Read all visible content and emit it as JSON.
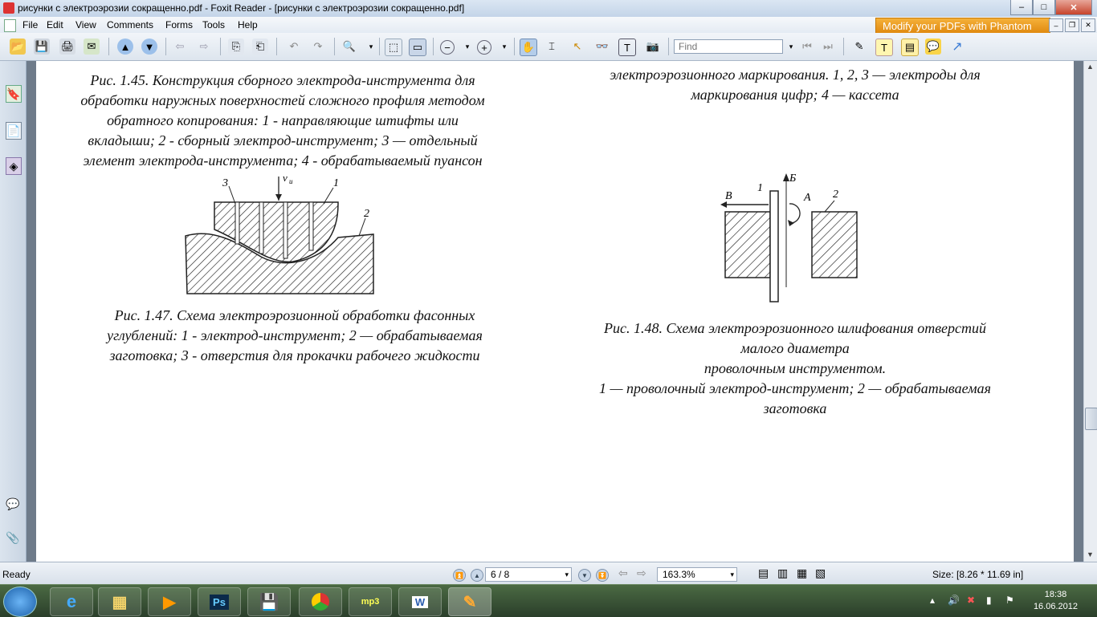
{
  "window": {
    "title": "рисунки с электроэрозии сокращенно.pdf - Foxit Reader - [рисунки с электроэрозии сокращенно.pdf]",
    "minimize": "‒",
    "maximize": "□",
    "close": "✕"
  },
  "menu": {
    "items": [
      "File",
      "Edit",
      "View",
      "Comments",
      "Forms",
      "Tools",
      "Help"
    ],
    "promo": "Modify your PDFs with Phantom",
    "mdi": [
      "–",
      "❐",
      "✕"
    ]
  },
  "toolbar": {
    "find_placeholder": "Find",
    "icons": [
      "open-icon",
      "save-icon",
      "print-icon",
      "email-icon",
      "prev-page-icon",
      "next-page-icon",
      "back-icon",
      "forward-icon",
      "page-extract-icon",
      "page-insert-icon",
      "undo-icon",
      "redo-icon",
      "zoom-in-icon",
      "fit-page-icon",
      "fit-width-icon",
      "zoom-out-icon",
      "zoom-plus-icon",
      "hand-icon",
      "select-text-icon",
      "select-icon",
      "find-icon",
      "typewriter-icon",
      "snapshot-icon",
      "prev-find-icon",
      "next-find-icon",
      "pencil-icon",
      "highlight-icon",
      "note-icon",
      "arrow-tool-icon"
    ]
  },
  "document": {
    "captions": {
      "fig145": [
        "Рис. 1.45. Конструкция сборного электрода-инструмента для",
        "обработки наружных поверхностей сложного профиля методом",
        "обратного копирования: 1 - направляющие штифты или",
        "вкладыши; 2 - сборный электрод-инструмент; 3 — отдельный",
        "элемент электрода-инструмента; 4 - обрабатываемый пуансон"
      ],
      "fig146_tail": [
        "электроэрозионного маркирования. 1, 2, 3 — электроды для",
        "маркирования цифр; 4 — кассета"
      ],
      "fig147": [
        "Рис. 1.47. Схема электроэрозионной обработки фасонных",
        "углублений: 1 - электрод-инструмент; 2 — обрабатываемая",
        "заготовка; 3 - отверстия для прокачки рабочего жидкости"
      ],
      "fig148": [
        "Рис. 1.48. Схема электроэрозионного шлифования отверстий",
        "малого диаметра",
        "проволочным инструментом.",
        "1 — проволочный электрод-инструмент; 2 — обрабатываемая",
        "заготовка"
      ]
    },
    "fig147_labels": {
      "l3": "3",
      "lv": "v",
      "lv_sub": "u",
      "l1": "1",
      "l2": "2"
    },
    "fig148_labels": {
      "lB_left": "В",
      "l1": "1",
      "lB_up": "Б",
      "lA": "А",
      "l2": "2"
    }
  },
  "status": {
    "ready": "Ready",
    "page": "6 / 8",
    "zoom": "163.3%",
    "size": "Size: [8.26 * 11.69 in]"
  },
  "taskbar": {
    "apps": [
      "ie-icon",
      "explorer-icon",
      "media-player-icon",
      "photoshop-icon",
      "save-disk-icon",
      "chrome-icon",
      "mp3-cut-icon",
      "word-icon",
      "foxit-icon"
    ],
    "ps_label": "Ps",
    "mp3_label": "mp3",
    "word_label": "W",
    "time": "18:38",
    "date": "16.06.2012"
  },
  "colors": {
    "titlebar": "#c3d4e8",
    "promo": "#e08a10",
    "taskbar": "#2a3e2a",
    "page": "#ffffff"
  }
}
